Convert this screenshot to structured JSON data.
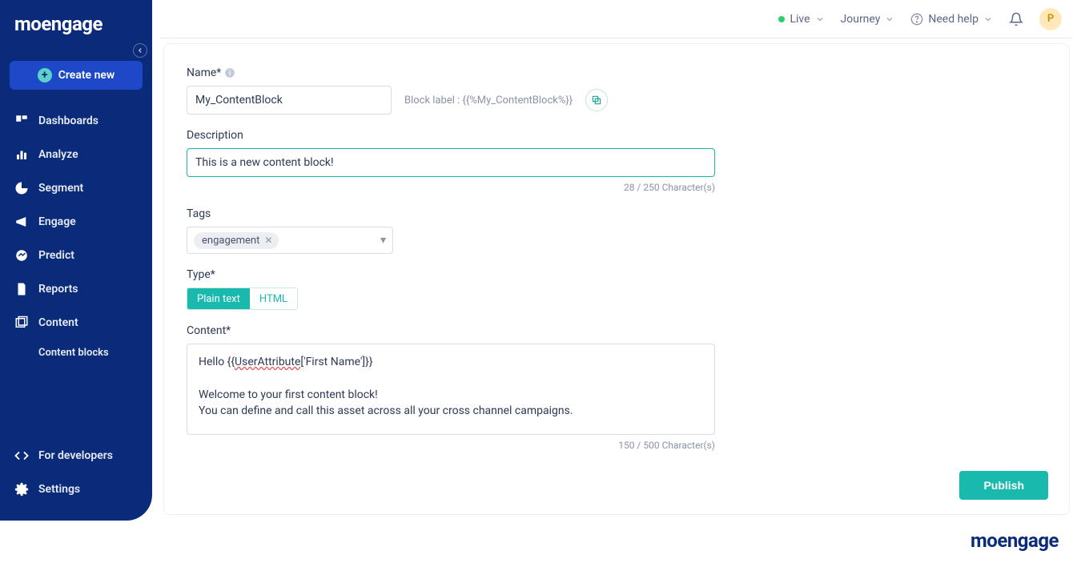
{
  "brand": "moengage",
  "sidebar": {
    "create_label": "Create new",
    "items": [
      {
        "label": "Dashboards"
      },
      {
        "label": "Analyze"
      },
      {
        "label": "Segment"
      },
      {
        "label": "Engage"
      },
      {
        "label": "Predict"
      },
      {
        "label": "Reports"
      },
      {
        "label": "Content"
      }
    ],
    "sub_item": "Content blocks",
    "for_developers": "For developers",
    "settings": "Settings"
  },
  "topbar": {
    "live": "Live",
    "journey": "Journey",
    "need_help": "Need help",
    "avatar_initial": "P"
  },
  "form": {
    "name_label": "Name*",
    "name_value": "My_ContentBlock",
    "block_label_text": "Block label : {{%My_ContentBlock%}}",
    "description_label": "Description",
    "description_value": "This is a new content block!",
    "description_counter": "28 / 250 Character(s)",
    "tags_label": "Tags",
    "tag_value": "engagement",
    "type_label": "Type*",
    "type_plain": "Plain text",
    "type_html": "HTML",
    "content_label": "Content*",
    "content_value": "Hello {{UserAttribute['First Name']}}\n\nWelcome to your first content block!\nYou can define and call this asset across all your cross channel campaigns.",
    "content_line1_pre": "Hello {{",
    "content_line1_underline": "UserAttribute",
    "content_line1_post": "['First Name']}}",
    "content_line3": "Welcome to your first content block!",
    "content_line4": "You can define and call this asset across all your cross channel campaigns.",
    "content_counter": "150 / 500 Character(s)",
    "publish": "Publish"
  },
  "footer_brand": "moengage"
}
